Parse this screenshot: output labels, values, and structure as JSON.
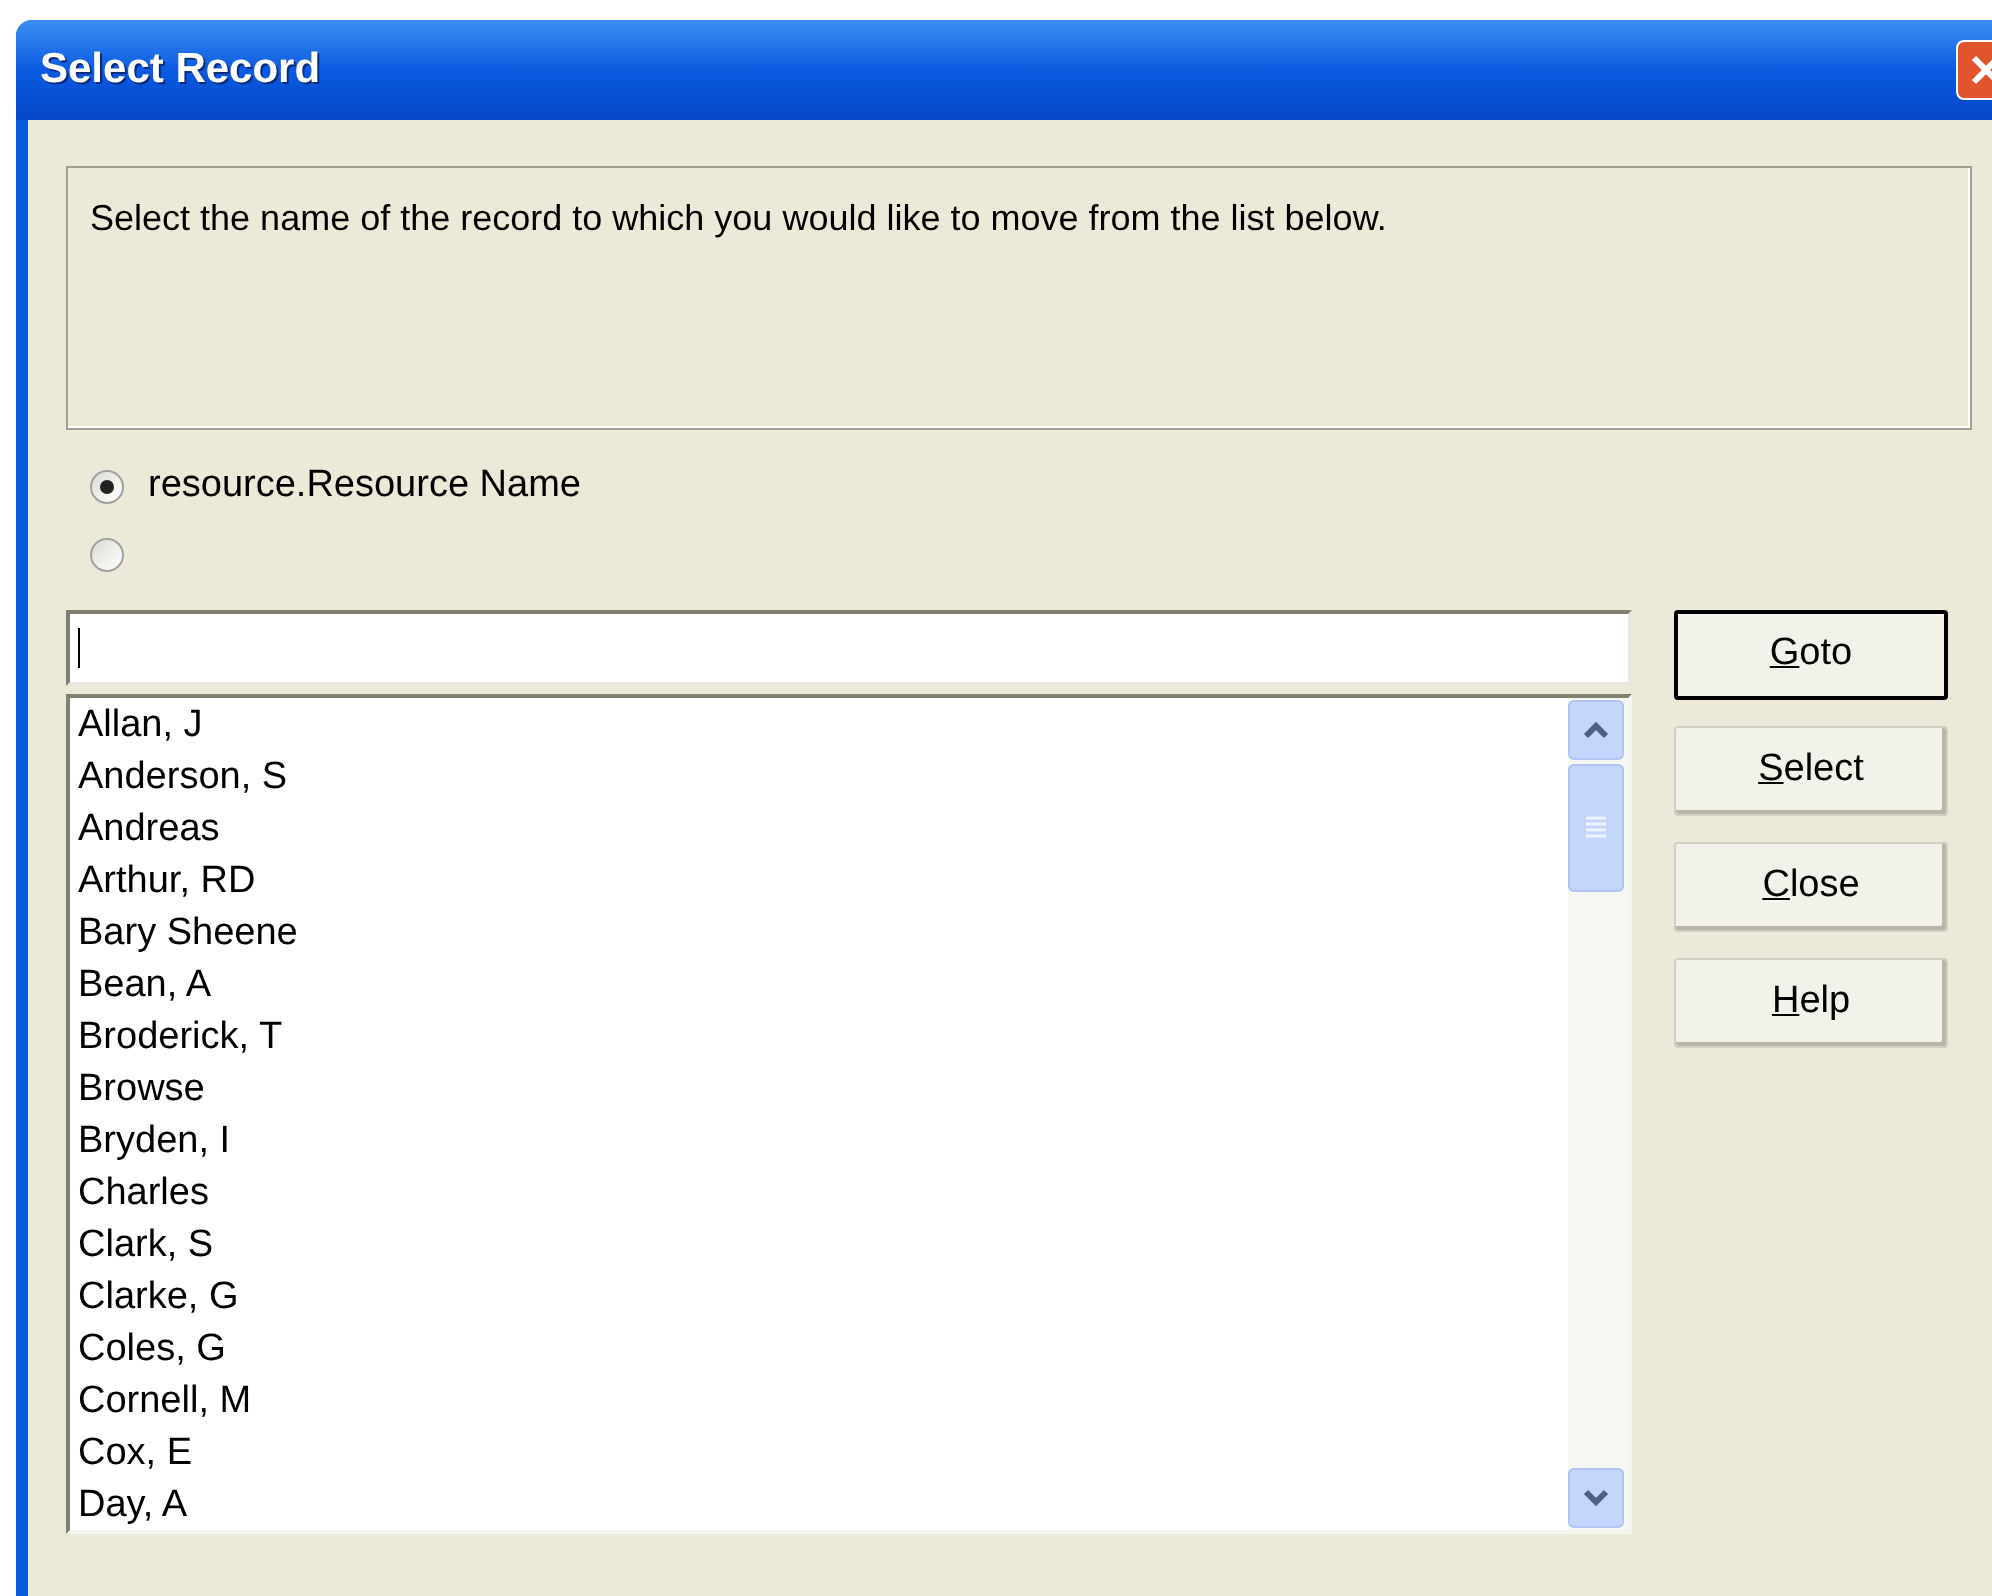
{
  "window": {
    "title": "Select Record"
  },
  "instructions": "Select the name of the record to which you would like to move from the list below.",
  "options": [
    {
      "label": "resource.Resource Name",
      "selected": true
    },
    {
      "selected": false
    }
  ],
  "records": [
    "Allan, J",
    "Anderson, S",
    "Andreas",
    "Arthur, RD",
    "Bary Sheene",
    "Bean, A",
    "Broderick, T",
    "Browse",
    "Bryden, I",
    "Charles",
    "Clark, S",
    "Clarke, G",
    "Coles, G",
    "Cornell, M",
    "Cox, E",
    "Day, A"
  ],
  "buttons": [
    {
      "label": "Goto",
      "default": true
    },
    {
      "label": "Select",
      "default": false
    },
    {
      "label": "Close",
      "default": false
    },
    {
      "label": "Help",
      "default": false
    }
  ]
}
